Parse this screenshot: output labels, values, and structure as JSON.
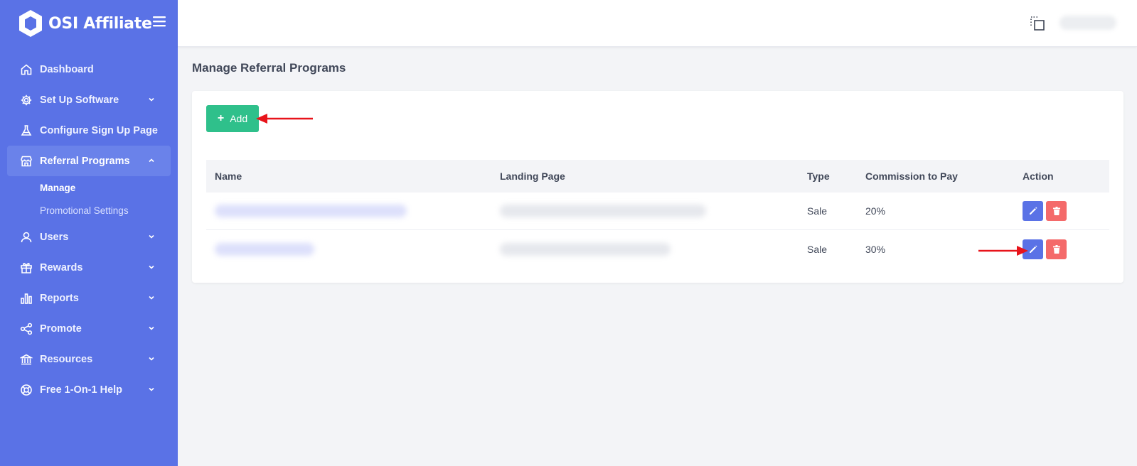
{
  "brand": {
    "name": "OSI Affiliate"
  },
  "sidebar": {
    "items": [
      {
        "label": "Dashboard",
        "icon": "home-icon",
        "has_chevron": false
      },
      {
        "label": "Set Up Software",
        "icon": "gear-icon",
        "has_chevron": true
      },
      {
        "label": "Configure Sign Up Page",
        "icon": "flask-icon",
        "has_chevron": false
      },
      {
        "label": "Referral Programs",
        "icon": "store-icon",
        "has_chevron": true,
        "expanded": true
      },
      {
        "label": "Users",
        "icon": "user-icon",
        "has_chevron": true
      },
      {
        "label": "Rewards",
        "icon": "gift-icon",
        "has_chevron": true
      },
      {
        "label": "Reports",
        "icon": "bar-chart-icon",
        "has_chevron": true
      },
      {
        "label": "Promote",
        "icon": "share-icon",
        "has_chevron": true
      },
      {
        "label": "Resources",
        "icon": "bank-icon",
        "has_chevron": true
      },
      {
        "label": "Free 1-On-1 Help",
        "icon": "lifebuoy-icon",
        "has_chevron": true
      }
    ],
    "sub_items": [
      {
        "label": "Manage",
        "current": true
      },
      {
        "label": "Promotional Settings",
        "current": false
      }
    ]
  },
  "page": {
    "title": "Manage Referral Programs"
  },
  "toolbar": {
    "add_label": "Add"
  },
  "table": {
    "headers": [
      "Name",
      "Landing Page",
      "Type",
      "Commission to Pay",
      "Action"
    ],
    "rows": [
      {
        "type": "Sale",
        "commission": "20%"
      },
      {
        "type": "Sale",
        "commission": "30%"
      }
    ]
  },
  "colors": {
    "sidebar": "#5a72e6",
    "add_button": "#2fc08b",
    "edit_button": "#5a72e6",
    "delete_button": "#f46a6a",
    "annotation_arrow": "#e8141b"
  }
}
